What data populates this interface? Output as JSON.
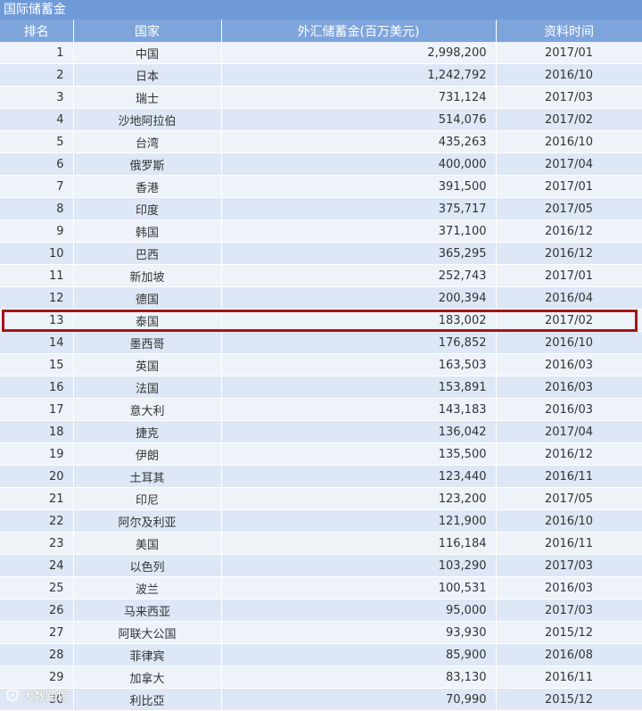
{
  "title": "国际储蓄金",
  "headers": {
    "rank": "排名",
    "country": "国家",
    "reserves": "外汇储蓄金(百万美元)",
    "date": "资料时间"
  },
  "rows": [
    {
      "rank": "1",
      "country": "中国",
      "reserves": "2,998,200",
      "date": "2017/01"
    },
    {
      "rank": "2",
      "country": "日本",
      "reserves": "1,242,792",
      "date": "2016/10"
    },
    {
      "rank": "3",
      "country": "瑞士",
      "reserves": "731,124",
      "date": "2017/03"
    },
    {
      "rank": "4",
      "country": "沙地阿拉伯",
      "reserves": "514,076",
      "date": "2017/02"
    },
    {
      "rank": "5",
      "country": "台湾",
      "reserves": "435,263",
      "date": "2016/10"
    },
    {
      "rank": "6",
      "country": "俄罗斯",
      "reserves": "400,000",
      "date": "2017/04"
    },
    {
      "rank": "7",
      "country": "香港",
      "reserves": "391,500",
      "date": "2017/01"
    },
    {
      "rank": "8",
      "country": "印度",
      "reserves": "375,717",
      "date": "2017/05"
    },
    {
      "rank": "9",
      "country": "韩国",
      "reserves": "371,100",
      "date": "2016/12"
    },
    {
      "rank": "10",
      "country": "巴西",
      "reserves": "365,295",
      "date": "2016/12"
    },
    {
      "rank": "11",
      "country": "新加坡",
      "reserves": "252,743",
      "date": "2017/01"
    },
    {
      "rank": "12",
      "country": "德国",
      "reserves": "200,394",
      "date": "2016/04"
    },
    {
      "rank": "13",
      "country": "泰国",
      "reserves": "183,002",
      "date": "2017/02"
    },
    {
      "rank": "14",
      "country": "墨西哥",
      "reserves": "176,852",
      "date": "2016/10"
    },
    {
      "rank": "15",
      "country": "英国",
      "reserves": "163,503",
      "date": "2016/03"
    },
    {
      "rank": "16",
      "country": "法国",
      "reserves": "153,891",
      "date": "2016/03"
    },
    {
      "rank": "17",
      "country": "意大利",
      "reserves": "143,183",
      "date": "2016/03"
    },
    {
      "rank": "18",
      "country": "捷克",
      "reserves": "136,042",
      "date": "2017/04"
    },
    {
      "rank": "19",
      "country": "伊朗",
      "reserves": "135,500",
      "date": "2016/12"
    },
    {
      "rank": "20",
      "country": "土耳其",
      "reserves": "123,440",
      "date": "2016/11"
    },
    {
      "rank": "21",
      "country": "印尼",
      "reserves": "123,200",
      "date": "2017/05"
    },
    {
      "rank": "22",
      "country": "阿尔及利亚",
      "reserves": "121,900",
      "date": "2016/10"
    },
    {
      "rank": "23",
      "country": "美国",
      "reserves": "116,184",
      "date": "2016/11"
    },
    {
      "rank": "24",
      "country": "以色列",
      "reserves": "103,290",
      "date": "2017/03"
    },
    {
      "rank": "25",
      "country": "波兰",
      "reserves": "100,531",
      "date": "2016/03"
    },
    {
      "rank": "26",
      "country": "马来西亚",
      "reserves": "95,000",
      "date": "2017/03"
    },
    {
      "rank": "27",
      "country": "阿联大公国",
      "reserves": "93,930",
      "date": "2015/12"
    },
    {
      "rank": "28",
      "country": "菲律宾",
      "reserves": "85,900",
      "date": "2016/08"
    },
    {
      "rank": "29",
      "country": "加拿大",
      "reserves": "83,130",
      "date": "2016/11"
    },
    {
      "rank": "30",
      "country": "利比亞",
      "reserves": "70,990",
      "date": "2015/12"
    }
  ],
  "highlight_rank": "13",
  "watermark": "大数跨境",
  "colors": {
    "header_bg": "#7ea4dc",
    "title_bg": "#6f9ad8",
    "row_light": "#eef3fa",
    "row_dark": "#dde7f5",
    "highlight_border": "#a5141a"
  }
}
